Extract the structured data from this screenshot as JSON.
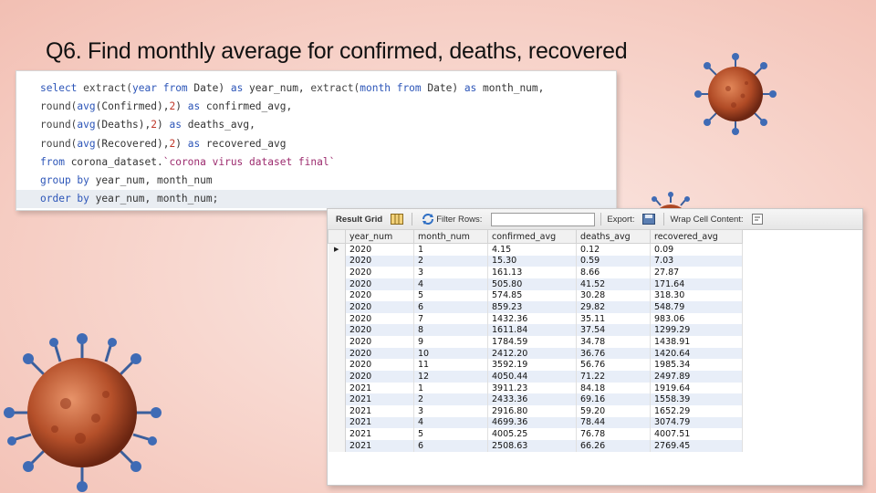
{
  "title": "Q6. Find monthly average for confirmed, deaths, recovered",
  "sql": {
    "line1": {
      "k1": "select",
      "f1": " extract(",
      "k2": "year from",
      "t1": " Date) ",
      "k3": "as",
      "t2": " year_num, ",
      "f2": "extract(",
      "k4": "month from",
      "t3": " Date) ",
      "k5": "as",
      "t4": " month_num,"
    },
    "line2": {
      "f1": "round(",
      "k1": "avg",
      "t1": "(Confirmed),",
      "n1": "2",
      "t2": ") ",
      "k2": "as",
      "t3": " confirmed_avg,"
    },
    "line3": {
      "f1": "round(",
      "k1": "avg",
      "t1": "(Deaths),",
      "n1": "2",
      "t2": ") ",
      "k2": "as",
      "t3": " deaths_avg,"
    },
    "line4": {
      "f1": "round(",
      "k1": "avg",
      "t1": "(Recovered),",
      "n1": "2",
      "t2": ") ",
      "k2": "as",
      "t3": " recovered_avg"
    },
    "line5": {
      "k1": "from",
      "t1": " corona_dataset.",
      "s1": "`corona virus dataset final`"
    },
    "line6": {
      "k1": "group by",
      "t1": " year_num, month_num"
    },
    "line7": {
      "k1": "order by",
      "t1": " year_num, month_num;"
    }
  },
  "toolbar": {
    "result_grid": "Result Grid",
    "filter_rows": "Filter Rows:",
    "export": "Export:",
    "wrap_cell": "Wrap Cell Content:"
  },
  "grid": {
    "columns": [
      "year_num",
      "month_num",
      "confirmed_avg",
      "deaths_avg",
      "recovered_avg"
    ],
    "rows": [
      [
        "2020",
        "1",
        "4.15",
        "0.12",
        "0.09"
      ],
      [
        "2020",
        "2",
        "15.30",
        "0.59",
        "7.03"
      ],
      [
        "2020",
        "3",
        "161.13",
        "8.66",
        "27.87"
      ],
      [
        "2020",
        "4",
        "505.80",
        "41.52",
        "171.64"
      ],
      [
        "2020",
        "5",
        "574.85",
        "30.28",
        "318.30"
      ],
      [
        "2020",
        "6",
        "859.23",
        "29.82",
        "548.79"
      ],
      [
        "2020",
        "7",
        "1432.36",
        "35.11",
        "983.06"
      ],
      [
        "2020",
        "8",
        "1611.84",
        "37.54",
        "1299.29"
      ],
      [
        "2020",
        "9",
        "1784.59",
        "34.78",
        "1438.91"
      ],
      [
        "2020",
        "10",
        "2412.20",
        "36.76",
        "1420.64"
      ],
      [
        "2020",
        "11",
        "3592.19",
        "56.76",
        "1985.34"
      ],
      [
        "2020",
        "12",
        "4050.44",
        "71.22",
        "2497.89"
      ],
      [
        "2021",
        "1",
        "3911.23",
        "84.18",
        "1919.64"
      ],
      [
        "2021",
        "2",
        "2433.36",
        "69.16",
        "1558.39"
      ],
      [
        "2021",
        "3",
        "2916.80",
        "59.20",
        "1652.29"
      ],
      [
        "2021",
        "4",
        "4699.36",
        "78.44",
        "3074.79"
      ],
      [
        "2021",
        "5",
        "4005.25",
        "76.78",
        "4007.51"
      ],
      [
        "2021",
        "6",
        "2508.63",
        "66.26",
        "2769.45"
      ]
    ]
  },
  "icons": [
    "virus-icon",
    "grid-icon",
    "refresh-icon",
    "export-icon",
    "wrap-icon",
    "row-pointer-icon"
  ],
  "colors": {
    "keyword": "#2c55b8",
    "number": "#c0392b",
    "string": "#9c2b6e",
    "row_alt": "#e8eef8"
  }
}
